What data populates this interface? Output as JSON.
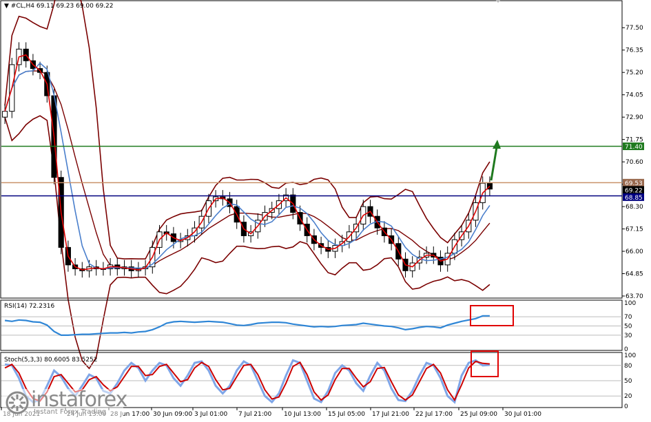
{
  "chart_data": [
    {
      "type": "candlestick",
      "instrument_header": "▼ #CL,H4  69.11 69.23 69.00 69.22",
      "ylim": [
        63.7,
        78.5
      ],
      "y_ticks": [
        "77.50",
        "76.35",
        "75.20",
        "74.05",
        "72.90",
        "71.75",
        "70.60",
        "69.45",
        "68.30",
        "67.15",
        "66.00",
        "64.85",
        "63.70"
      ],
      "x_ticks": [
        "18 Jun 2021",
        "24 Jun 13:00",
        "28 Jun 17:00",
        "30 Jun 09:00",
        "3 Jul 01:00",
        "7 Jul 21:00",
        "10 Jul 13:00",
        "15 Jul 05:00",
        "17 Jul 21:00",
        "22 Jul 17:00",
        "25 Jul 09:00",
        "30 Jul 01:00"
      ],
      "close_series": [
        73.2,
        75.6,
        76.4,
        75.8,
        75.4,
        75.2,
        74.0,
        69.8,
        66.2,
        65.3,
        65.1,
        65.0,
        65.2,
        65.1,
        65.1,
        65.3,
        65.1,
        65.2,
        65.0,
        65.1,
        65.2,
        66.2,
        67.0,
        66.9,
        66.5,
        66.6,
        66.8,
        67.2,
        67.8,
        68.6,
        68.8,
        68.7,
        68.3,
        67.5,
        66.8,
        67.0,
        67.6,
        68.0,
        68.2,
        68.6,
        68.9,
        68.0,
        67.4,
        66.8,
        66.4,
        66.2,
        66.0,
        66.3,
        66.5,
        67.0,
        67.4,
        68.3,
        67.8,
        67.2,
        66.8,
        66.4,
        65.6,
        65.0,
        65.4,
        65.7,
        65.9,
        65.7,
        65.3,
        65.9,
        66.6,
        67.0,
        67.6,
        68.5,
        69.5,
        69.2
      ],
      "price_tags": [
        {
          "label": "71.40",
          "value": 71.4,
          "color": "#1f7a1f"
        },
        {
          "label": "69.53",
          "value": 69.53,
          "color": "#9a6a4f"
        },
        {
          "label": "69.22",
          "value": 69.22,
          "color": "#000000"
        },
        {
          "label": "68.85",
          "value": 68.85,
          "color": "#00007f"
        }
      ],
      "horizontal_levels": [
        {
          "value": 71.4,
          "color": "#1f7a1f"
        },
        {
          "value": 69.53,
          "color": "#c9926a"
        },
        {
          "value": 68.85,
          "color": "#00007f"
        }
      ],
      "annotation": "green upward arrow toward 71.40"
    },
    {
      "type": "line",
      "header": "RSI(14) 72.2316",
      "ylim": [
        0,
        100
      ],
      "y_ticks": [
        "100",
        "70",
        "50",
        "30",
        "0"
      ],
      "levels": [
        70,
        50,
        30
      ],
      "values": [
        62,
        60,
        63,
        62,
        59,
        58,
        52,
        38,
        30,
        30,
        31,
        32,
        32,
        33,
        34,
        35,
        35,
        36,
        35,
        37,
        38,
        42,
        48,
        56,
        59,
        60,
        59,
        58,
        59,
        60,
        59,
        58,
        55,
        52,
        51,
        53,
        56,
        57,
        58,
        58,
        57,
        54,
        52,
        50,
        48,
        49,
        48,
        49,
        51,
        52,
        53,
        56,
        54,
        52,
        50,
        49,
        46,
        42,
        44,
        47,
        49,
        48,
        46,
        52,
        56,
        60,
        63,
        66,
        72,
        72
      ]
    },
    {
      "type": "line",
      "header": "Stoch(5,3,3) 80.6005 83.5252",
      "ylim": [
        0,
        100
      ],
      "y_ticks": [
        "100",
        "80",
        "50",
        "20",
        "0"
      ],
      "levels": [
        80,
        50,
        20
      ],
      "series": [
        {
          "values": [
            82,
            80,
            55,
            20,
            8,
            12,
            40,
            70,
            58,
            35,
            20,
            40,
            62,
            55,
            30,
            25,
            45,
            70,
            85,
            75,
            50,
            70,
            85,
            80,
            55,
            40,
            60,
            85,
            88,
            70,
            40,
            25,
            40,
            70,
            88,
            80,
            50,
            20,
            8,
            25,
            60,
            90,
            85,
            50,
            15,
            8,
            30,
            65,
            80,
            70,
            45,
            30,
            60,
            85,
            70,
            35,
            12,
            10,
            30,
            60,
            85,
            80,
            55,
            20,
            8,
            60,
            85,
            90,
            80,
            81
          ],
          "color": "#1f3fff"
        },
        {
          "values": [
            75,
            82,
            65,
            35,
            15,
            10,
            28,
            58,
            62,
            45,
            28,
            32,
            52,
            58,
            42,
            30,
            38,
            58,
            78,
            78,
            60,
            62,
            78,
            82,
            65,
            48,
            52,
            75,
            86,
            78,
            52,
            32,
            35,
            58,
            80,
            82,
            62,
            32,
            14,
            18,
            45,
            78,
            86,
            62,
            28,
            12,
            22,
            52,
            74,
            74,
            55,
            38,
            48,
            74,
            76,
            48,
            22,
            12,
            22,
            48,
            74,
            82,
            65,
            32,
            12,
            42,
            75,
            88,
            84,
            83
          ],
          "color": "#cc0000"
        }
      ]
    }
  ],
  "watermark": {
    "brand": "instaforex",
    "tagline": "Instant Forex Trading"
  }
}
